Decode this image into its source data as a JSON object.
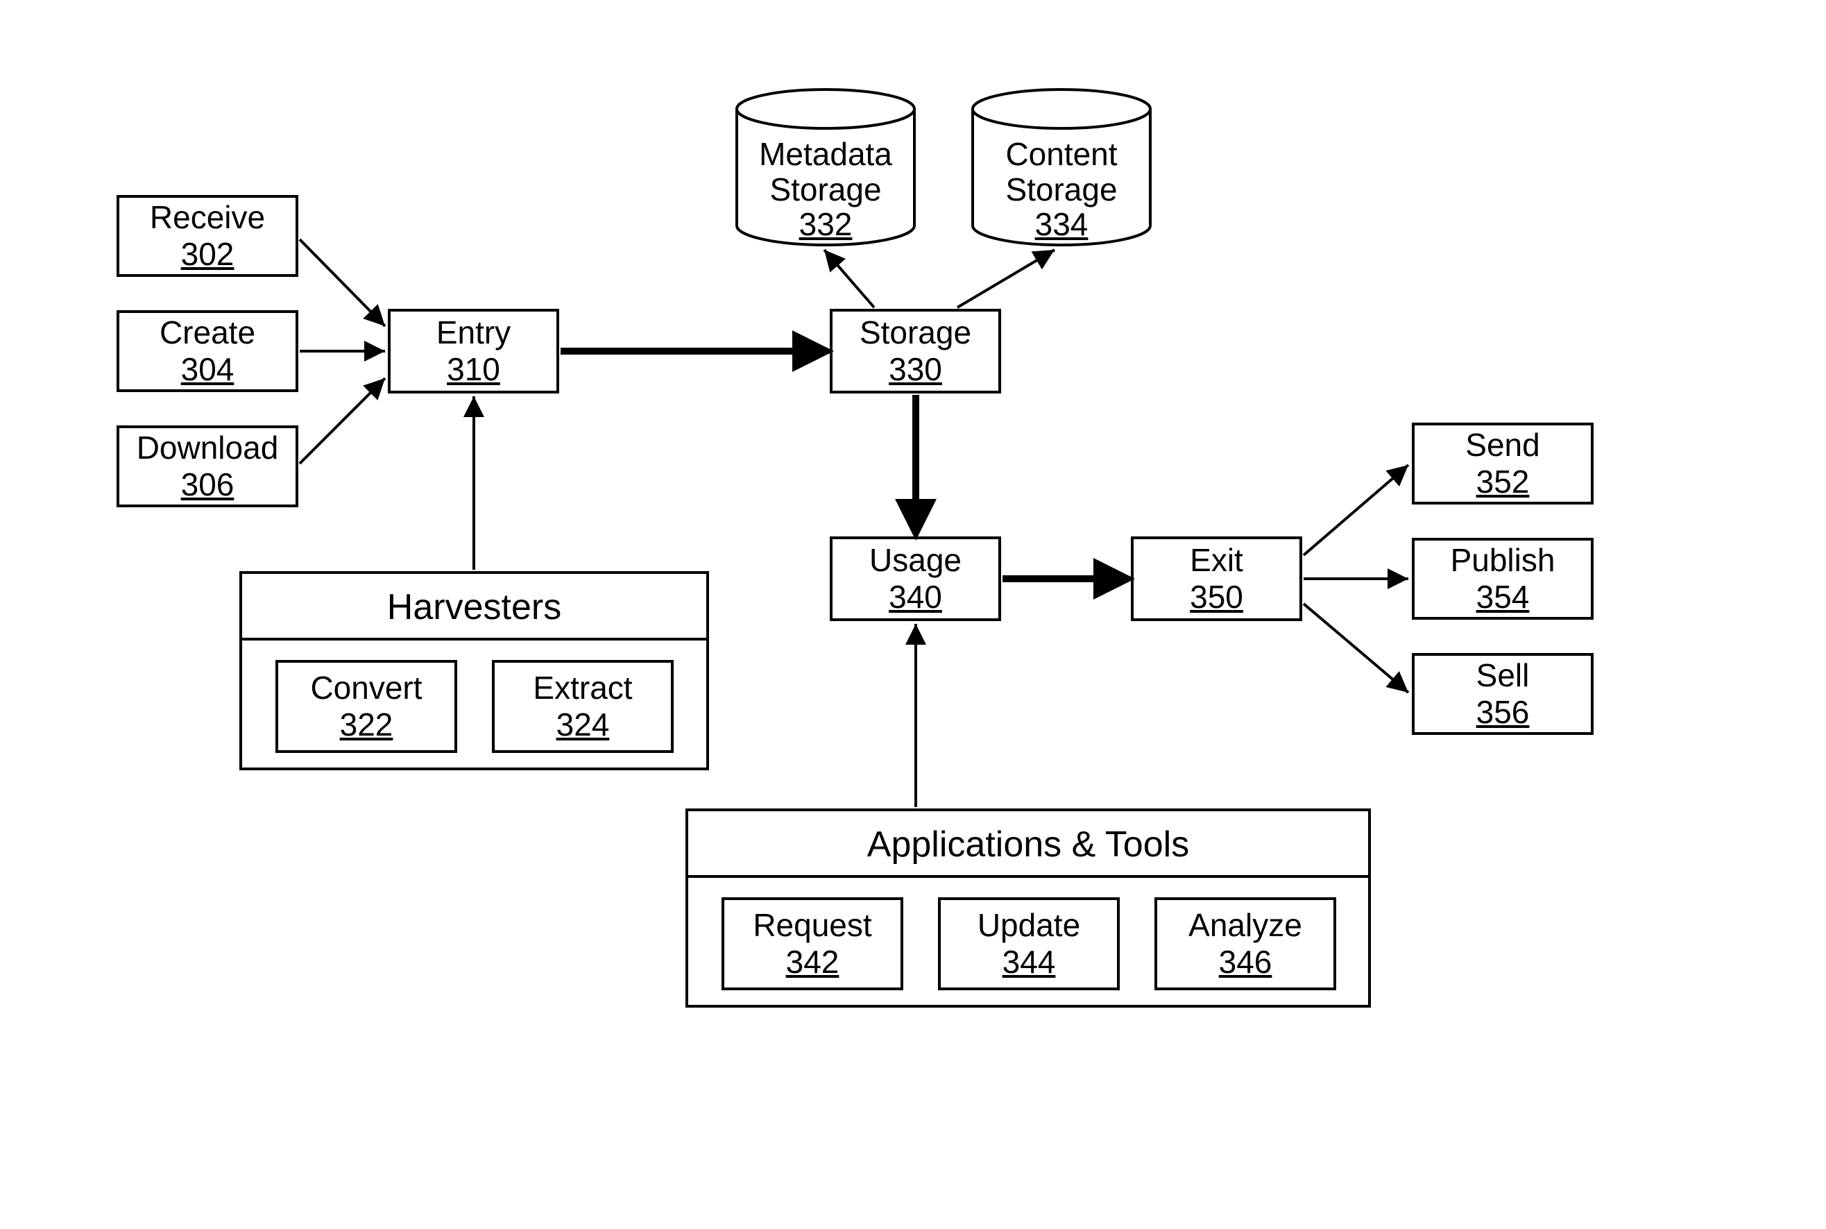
{
  "nodes": {
    "receive": {
      "label": "Receive",
      "num": "302"
    },
    "create": {
      "label": "Create",
      "num": "304"
    },
    "download": {
      "label": "Download",
      "num": "306"
    },
    "entry": {
      "label": "Entry",
      "num": "310"
    },
    "storage": {
      "label": "Storage",
      "num": "330"
    },
    "metadata": {
      "label1": "Metadata",
      "label2": "Storage",
      "num": "332"
    },
    "content": {
      "label1": "Content",
      "label2": "Storage",
      "num": "334"
    },
    "usage": {
      "label": "Usage",
      "num": "340"
    },
    "exit": {
      "label": "Exit",
      "num": "350"
    },
    "send": {
      "label": "Send",
      "num": "352"
    },
    "publish": {
      "label": "Publish",
      "num": "354"
    },
    "sell": {
      "label": "Sell",
      "num": "356"
    }
  },
  "harvesters": {
    "title": "Harvesters",
    "convert": {
      "label": "Convert",
      "num": "322"
    },
    "extract": {
      "label": "Extract",
      "num": "324"
    }
  },
  "apps": {
    "title": "Applications & Tools",
    "request": {
      "label": "Request",
      "num": "342"
    },
    "update": {
      "label": "Update",
      "num": "344"
    },
    "analyze": {
      "label": "Analyze",
      "num": "346"
    }
  }
}
